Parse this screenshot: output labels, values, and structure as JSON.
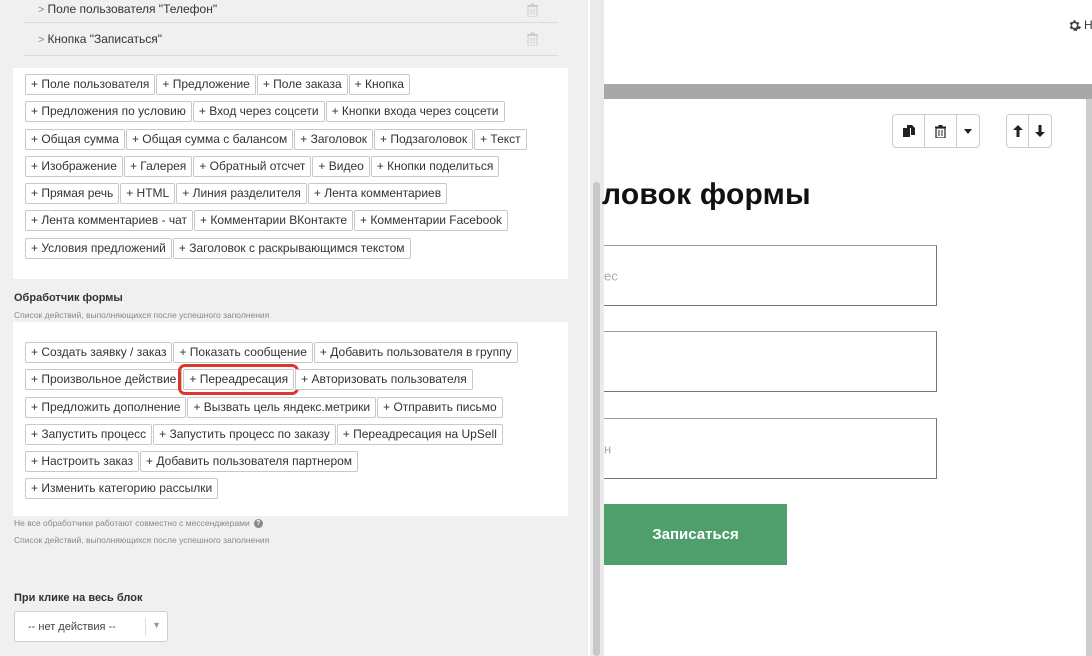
{
  "accordion": [
    {
      "label": "Поле пользователя \"Телефон\""
    },
    {
      "label": "Кнопка \"Записаться\""
    }
  ],
  "field_buttons": [
    [
      "+ Поле пользователя",
      "+ Предложение",
      "+ Поле заказа",
      "+ Кнопка"
    ],
    [
      "+ Предложения по условию",
      "+ Вход через соцсети",
      "+ Кнопки входа через соцсети"
    ],
    [
      "+ Общая сумма",
      "+ Общая сумма с балансом",
      "+ Заголовок",
      "+ Подзаголовок",
      "+ Текст"
    ],
    [
      "+ Изображение",
      "+ Галерея",
      "+ Обратный отсчет",
      "+ Видео",
      "+ Кнопки поделиться"
    ],
    [
      "+ Прямая речь",
      "+ HTML",
      "+ Линия разделителя",
      "+ Лента комментариев"
    ],
    [
      "+ Лента комментариев - чат",
      "+ Комментарии ВКонтакте",
      "+ Комментарии Facebook"
    ],
    [
      "+ Условия предложений",
      "+ Заголовок с раскрывающимся текстом"
    ]
  ],
  "handler": {
    "title": "Обработчик формы",
    "subtitle": "Список действий, выполняющихся после успешного заполнения",
    "buttons": [
      [
        "+ Создать заявку / заказ",
        "+ Показать сообщение",
        "+ Добавить пользователя в группу"
      ],
      [
        "+ Произвольное действие",
        "+ Переадресация",
        "+ Авторизовать пользователя"
      ],
      [
        "+ Предложить дополнение",
        "+ Вызвать цель яндекс.метрики",
        "+ Отправить письмо"
      ],
      [
        "+ Запустить процесс",
        "+ Запустить процесс по заказу",
        "+ Переадресация на UpSell"
      ],
      [
        "+ Настроить заказ",
        "+ Добавить пользователя партнером"
      ],
      [
        "+ Изменить категорию рассылки"
      ]
    ],
    "highlighted": "+ Переадресация",
    "note": "Не все обработчики работают совместно с мессенджерами",
    "note_sub": "Список действий, выполняющихся после успешного заполнения"
  },
  "click_block": {
    "title": "При клике на весь блок",
    "select_value": "-- нет действия --"
  },
  "right": {
    "gear_label": "Н",
    "form_title": "ловок формы",
    "inputs": [
      {
        "placeholder": "ес"
      },
      {
        "placeholder": ""
      },
      {
        "placeholder": "н"
      }
    ],
    "submit_label": "Записаться"
  },
  "colors": {
    "submit_bg": "#4f9f6c",
    "highlight": "#e0352b",
    "panel_bg": "#f0f0f0"
  }
}
